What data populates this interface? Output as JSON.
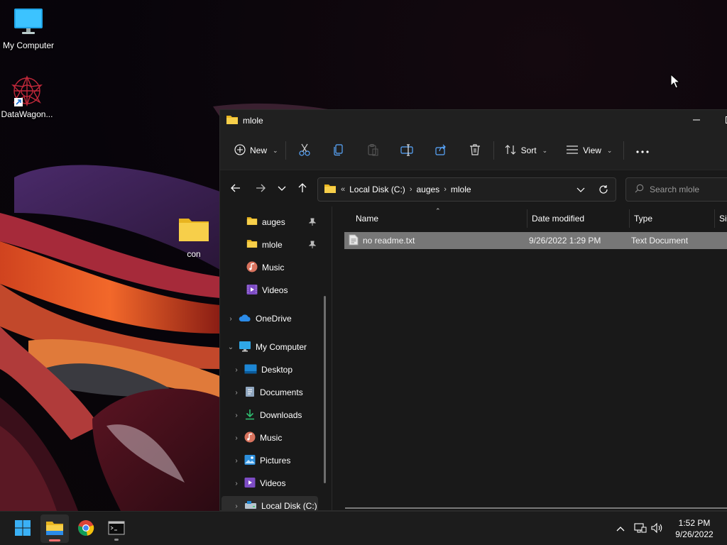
{
  "desktop": {
    "icons": [
      {
        "label": "My Computer",
        "icon": "monitor-icon"
      },
      {
        "label": "DataWagon...",
        "icon": "datawagon-shortcut-icon"
      },
      {
        "label": "con",
        "icon": "folder-icon"
      }
    ]
  },
  "explorer": {
    "title": "mlole",
    "commands": {
      "new_label": "New",
      "sort_label": "Sort",
      "view_label": "View"
    },
    "address": {
      "overflow": "«",
      "crumbs": [
        "Local Disk (C:)",
        "auges",
        "mlole"
      ]
    },
    "search_placeholder": "Search mlole",
    "nav": {
      "quick_access": [
        {
          "label": "auges",
          "icon": "folder-icon",
          "pinned": true
        },
        {
          "label": "mlole",
          "icon": "folder-icon",
          "pinned": true
        },
        {
          "label": "Music",
          "icon": "music-icon"
        },
        {
          "label": "Videos",
          "icon": "videos-icon"
        }
      ],
      "onedrive": "OneDrive",
      "my_computer": "My Computer",
      "computer_items": [
        {
          "label": "Desktop",
          "icon": "desktop-icon"
        },
        {
          "label": "Documents",
          "icon": "documents-icon"
        },
        {
          "label": "Downloads",
          "icon": "downloads-icon"
        },
        {
          "label": "Music",
          "icon": "music-icon"
        },
        {
          "label": "Pictures",
          "icon": "pictures-icon"
        },
        {
          "label": "Videos",
          "icon": "videos-icon"
        },
        {
          "label": "Local Disk (C:)",
          "icon": "drive-icon"
        }
      ]
    },
    "columns": {
      "name": "Name",
      "date": "Date modified",
      "type": "Type",
      "size": "Size"
    },
    "files": [
      {
        "name": "no readme.txt",
        "date": "9/26/2022 1:29 PM",
        "type": "Text Document"
      }
    ]
  },
  "taskbar": {
    "apps": [
      "start-icon",
      "file-explorer-icon",
      "chrome-icon",
      "terminal-icon"
    ],
    "clock": {
      "time": "1:52 PM",
      "date": "9/26/2022"
    }
  },
  "colors": {
    "accent_folder": "#f4c542",
    "selection": "#777777",
    "window_bg": "#191919"
  }
}
